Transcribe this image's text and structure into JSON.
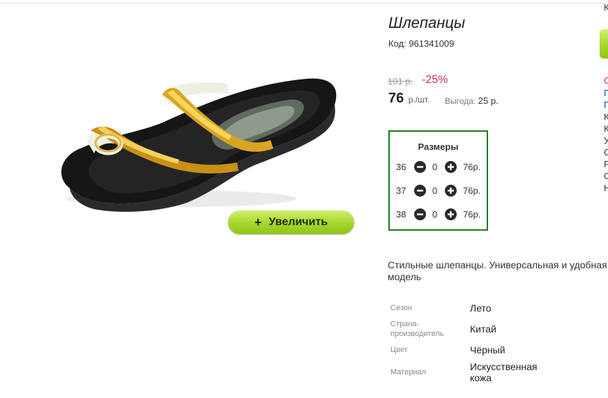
{
  "product": {
    "title": "Шлепанцы",
    "code": "Код: 961341009",
    "old_price": "101 р.",
    "discount": "-25%",
    "price": "76",
    "price_unit": "р./шт.",
    "savings_label": "Выгода:",
    "savings_value": "25 р.",
    "zoom_plus": "+",
    "zoom_label": "Увеличить",
    "description": "Стильные шлепанцы. Универсальная и удобная модель"
  },
  "sizes": {
    "title": "Размеры",
    "rows": [
      {
        "size": "36",
        "qty": "0",
        "price": "76р."
      },
      {
        "size": "37",
        "qty": "0",
        "price": "76р."
      },
      {
        "size": "38",
        "qty": "0",
        "price": "76р."
      }
    ]
  },
  "attributes": [
    {
      "label": "Сезон",
      "value": "Лето"
    },
    {
      "label": "Страна-производитель",
      "value": "Китай"
    },
    {
      "label": "Цвет",
      "value": "Чёрный"
    },
    {
      "label": "Материал",
      "value": "Искусственная кожа"
    }
  ],
  "right_column": {
    "top_letter": "К",
    "letters": [
      {
        "text": "С",
        "color": "#d72a2a"
      },
      {
        "text": "П",
        "color": "#1a3fb8"
      },
      {
        "text": "П",
        "color": "#1a3fb8"
      },
      {
        "text": "К",
        "color": "#333333"
      },
      {
        "text": "К",
        "color": "#333333"
      },
      {
        "text": "У",
        "color": "#333333"
      },
      {
        "text": "С",
        "color": "#333333"
      },
      {
        "text": "Р",
        "color": "#333333"
      },
      {
        "text": "С",
        "color": "#333333"
      },
      {
        "text": "Н",
        "color": "#333333"
      }
    ]
  },
  "colors": {
    "accent_green": "#a6d62a",
    "sizes_border": "#1c7a1c",
    "discount": "#d72a55"
  },
  "icons": {
    "minus": "minus-circle-icon",
    "plus": "plus-circle-icon"
  }
}
